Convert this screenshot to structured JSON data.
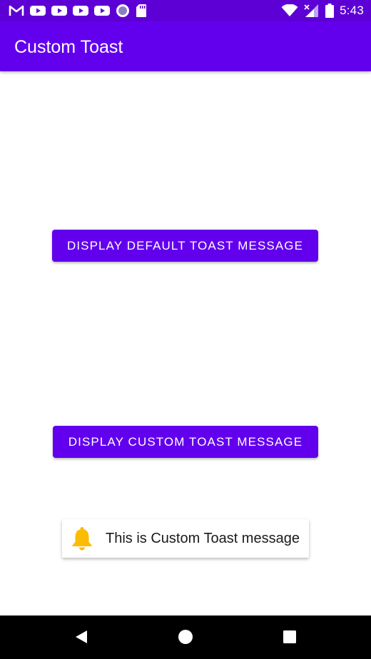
{
  "status_bar": {
    "time": "5:43",
    "left_icons": [
      "gmail-icon",
      "youtube-icon",
      "youtube-icon",
      "youtube-icon",
      "youtube-icon",
      "circle-record-icon",
      "sd-card-icon"
    ],
    "right_icons": [
      "wifi-icon",
      "signal-no-data-icon",
      "battery-icon"
    ],
    "background": "#5d00d6"
  },
  "app_bar": {
    "title": "Custom Toast",
    "background": "#6200ee"
  },
  "main": {
    "default_toast_button_label": "DISPLAY DEFAULT TOAST MESSAGE",
    "custom_toast_button_label": "DISPLAY CUSTOM TOAST MESSAGE",
    "button_color": "#6200ee"
  },
  "toast": {
    "icon": "bell-icon",
    "icon_color": "#fbbc05",
    "message": "This is Custom Toast message"
  },
  "nav_bar": {
    "buttons": [
      "back-icon",
      "home-icon",
      "recents-icon"
    ]
  }
}
